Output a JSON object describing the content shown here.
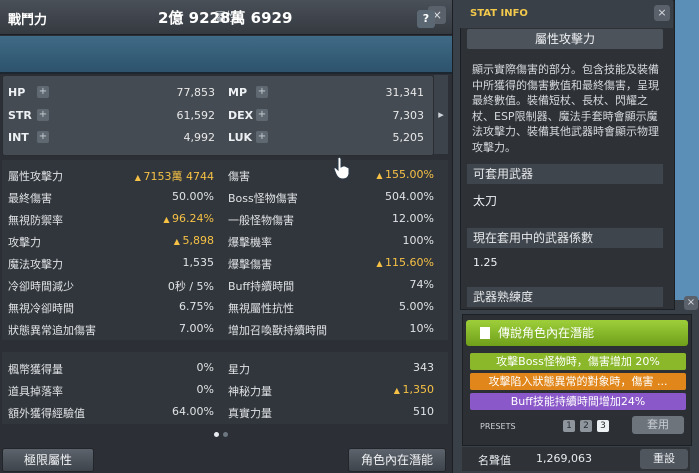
{
  "stat_window": {
    "title": "屬性",
    "close": "×",
    "combat_label": "戰鬥力",
    "combat_value": "2億 9228萬 6929",
    "help": "?",
    "basic": [
      {
        "label": "HP",
        "value": "77,853"
      },
      {
        "label": "MP",
        "value": "31,341"
      },
      {
        "label": "STR",
        "value": "61,592"
      },
      {
        "label": "DEX",
        "value": "7,303"
      },
      {
        "label": "INT",
        "value": "4,992"
      },
      {
        "label": "LUK",
        "value": "5,205"
      }
    ],
    "details_left": [
      {
        "label": "屬性攻擊力",
        "value": "7153萬 4744",
        "highlight": true
      },
      {
        "label": "最終傷害",
        "value": "50.00%"
      },
      {
        "label": "無視防禦率",
        "value": "96.24%",
        "highlight": true
      },
      {
        "label": "攻擊力",
        "value": "5,898",
        "highlight": true
      },
      {
        "label": "魔法攻擊力",
        "value": "1,535"
      },
      {
        "label": "冷卻時間減少",
        "value": "0秒 / 5%"
      },
      {
        "label": "無視冷卻時間",
        "value": "6.75%"
      },
      {
        "label": "狀態異常追加傷害",
        "value": "7.00%"
      }
    ],
    "details_right": [
      {
        "label": "傷害",
        "value": "155.00%",
        "highlight": true
      },
      {
        "label": "Boss怪物傷害",
        "value": "504.00%"
      },
      {
        "label": "一般怪物傷害",
        "value": "12.00%"
      },
      {
        "label": "爆擊機率",
        "value": "100%"
      },
      {
        "label": "爆擊傷害",
        "value": "115.60%",
        "highlight": true
      },
      {
        "label": "Buff持續時間",
        "value": "74%"
      },
      {
        "label": "無視屬性抗性",
        "value": "5.00%"
      },
      {
        "label": "增加召喚獸持續時間",
        "value": "10%"
      }
    ],
    "extra_left": [
      {
        "label": "楓幣獲得量",
        "value": "0%"
      },
      {
        "label": "道具掉落率",
        "value": "0%"
      },
      {
        "label": "額外獲得經驗值",
        "value": "64.00%"
      }
    ],
    "extra_right": [
      {
        "label": "星力",
        "value": "343"
      },
      {
        "label": "神秘力量",
        "value": "1,350",
        "highlight": true
      },
      {
        "label": "真實力量",
        "value": "510"
      }
    ],
    "button_hyper": "極限屬性",
    "button_inner": "角色內在潛能"
  },
  "stat_info": {
    "title": "STAT INFO",
    "close": "×",
    "tab": "屬性攻擊力",
    "description": "顯示實際傷害的部分。包含技能及裝備中所獲得的傷害數值和最終傷害，呈現最終數值。裝備短杖、長杖、閃耀之杖、ESP限制器、魔法手套時會顯示魔法攻擊力、裝備其他武器時會顯示物理攻擊力。",
    "usable_weapon_label": "可套用武器",
    "usable_weapon": "太刀",
    "coefficient_label": "現在套用中的武器係數",
    "coefficient": "1.25",
    "mastery_label": "武器熟練度"
  },
  "inner_ability": {
    "title": "傳說角色內在潛能",
    "lines": [
      "攻擊Boss怪物時，傷害增加 20%",
      "攻擊陷入狀態異常的對象時，傷害 ...",
      "Buff技能持續時間增加24%"
    ],
    "presets_label": "PRESETS",
    "presets": [
      "1",
      "2",
      "3"
    ],
    "apply": "套用",
    "fame_label": "名聲值",
    "fame_value": "1,269,063",
    "reset": "重設"
  },
  "colors": {
    "accent_yellow": "#f6c145",
    "legendary_green": "#8cc42c",
    "line_green": "#8ab82a",
    "line_orange": "#e0861a",
    "line_purple": "#8a58c8"
  }
}
